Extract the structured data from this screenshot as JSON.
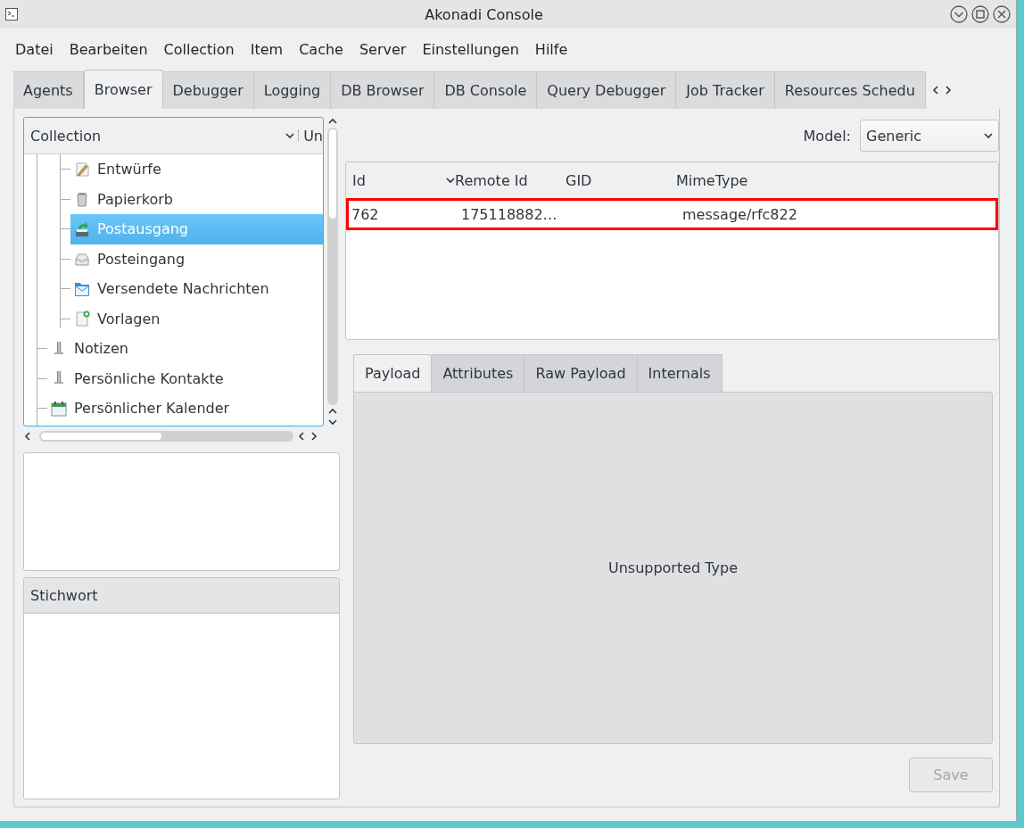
{
  "window": {
    "title": "Akonadi Console"
  },
  "menu": [
    "Datei",
    "Bearbeiten",
    "Collection",
    "Item",
    "Cache",
    "Server",
    "Einstellungen",
    "Hilfe"
  ],
  "tabs": [
    {
      "label": "Agents",
      "selected": false
    },
    {
      "label": "Browser",
      "selected": true
    },
    {
      "label": "Debugger",
      "selected": false
    },
    {
      "label": "Logging",
      "selected": false
    },
    {
      "label": "DB Browser",
      "selected": false
    },
    {
      "label": "DB Console",
      "selected": false
    },
    {
      "label": "Query Debugger",
      "selected": false
    },
    {
      "label": "Job Tracker",
      "selected": false
    },
    {
      "label": "Resources Schedu",
      "selected": false
    }
  ],
  "browser": {
    "tree": {
      "columns": [
        "Collection",
        "Un"
      ],
      "items": [
        {
          "children": [
            {
              "label": "Entwürfe",
              "kind": "drafts",
              "selected": false
            },
            {
              "label": "Papierkorb",
              "kind": "trash",
              "selected": false
            },
            {
              "label": "Postausgang",
              "kind": "outbox",
              "selected": true
            },
            {
              "label": "Posteingang",
              "kind": "inbox",
              "selected": false
            },
            {
              "label": "Versendete Nachrichten",
              "kind": "sent",
              "selected": false
            },
            {
              "label": "Vorlagen",
              "kind": "templates",
              "selected": false
            }
          ]
        },
        {
          "label": "Notizen",
          "kind": "resource",
          "selected": false
        },
        {
          "label": "Persönliche Kontakte",
          "kind": "resource",
          "selected": false
        },
        {
          "label": "Persönlicher Kalender",
          "kind": "calendar",
          "selected": false
        }
      ]
    },
    "keyword_list": {
      "header": "Stichwort"
    },
    "model": {
      "label": "Model:",
      "value": "Generic"
    },
    "items_table": {
      "columns": [
        "Id",
        "Remote Id",
        "GID",
        "MimeType"
      ],
      "rows": [
        {
          "id": "762",
          "remote_id": "175118882…",
          "mime_type": "message/rfc822",
          "highlighted": true
        }
      ]
    },
    "detail_tabs": [
      {
        "label": "Payload",
        "selected": true
      },
      {
        "label": "Attributes",
        "selected": false
      },
      {
        "label": "Raw Payload",
        "selected": false
      },
      {
        "label": "Internals",
        "selected": false
      }
    ],
    "payload": {
      "message": "Unsupported Type"
    },
    "save_button": {
      "label": "Save",
      "disabled": true
    }
  }
}
